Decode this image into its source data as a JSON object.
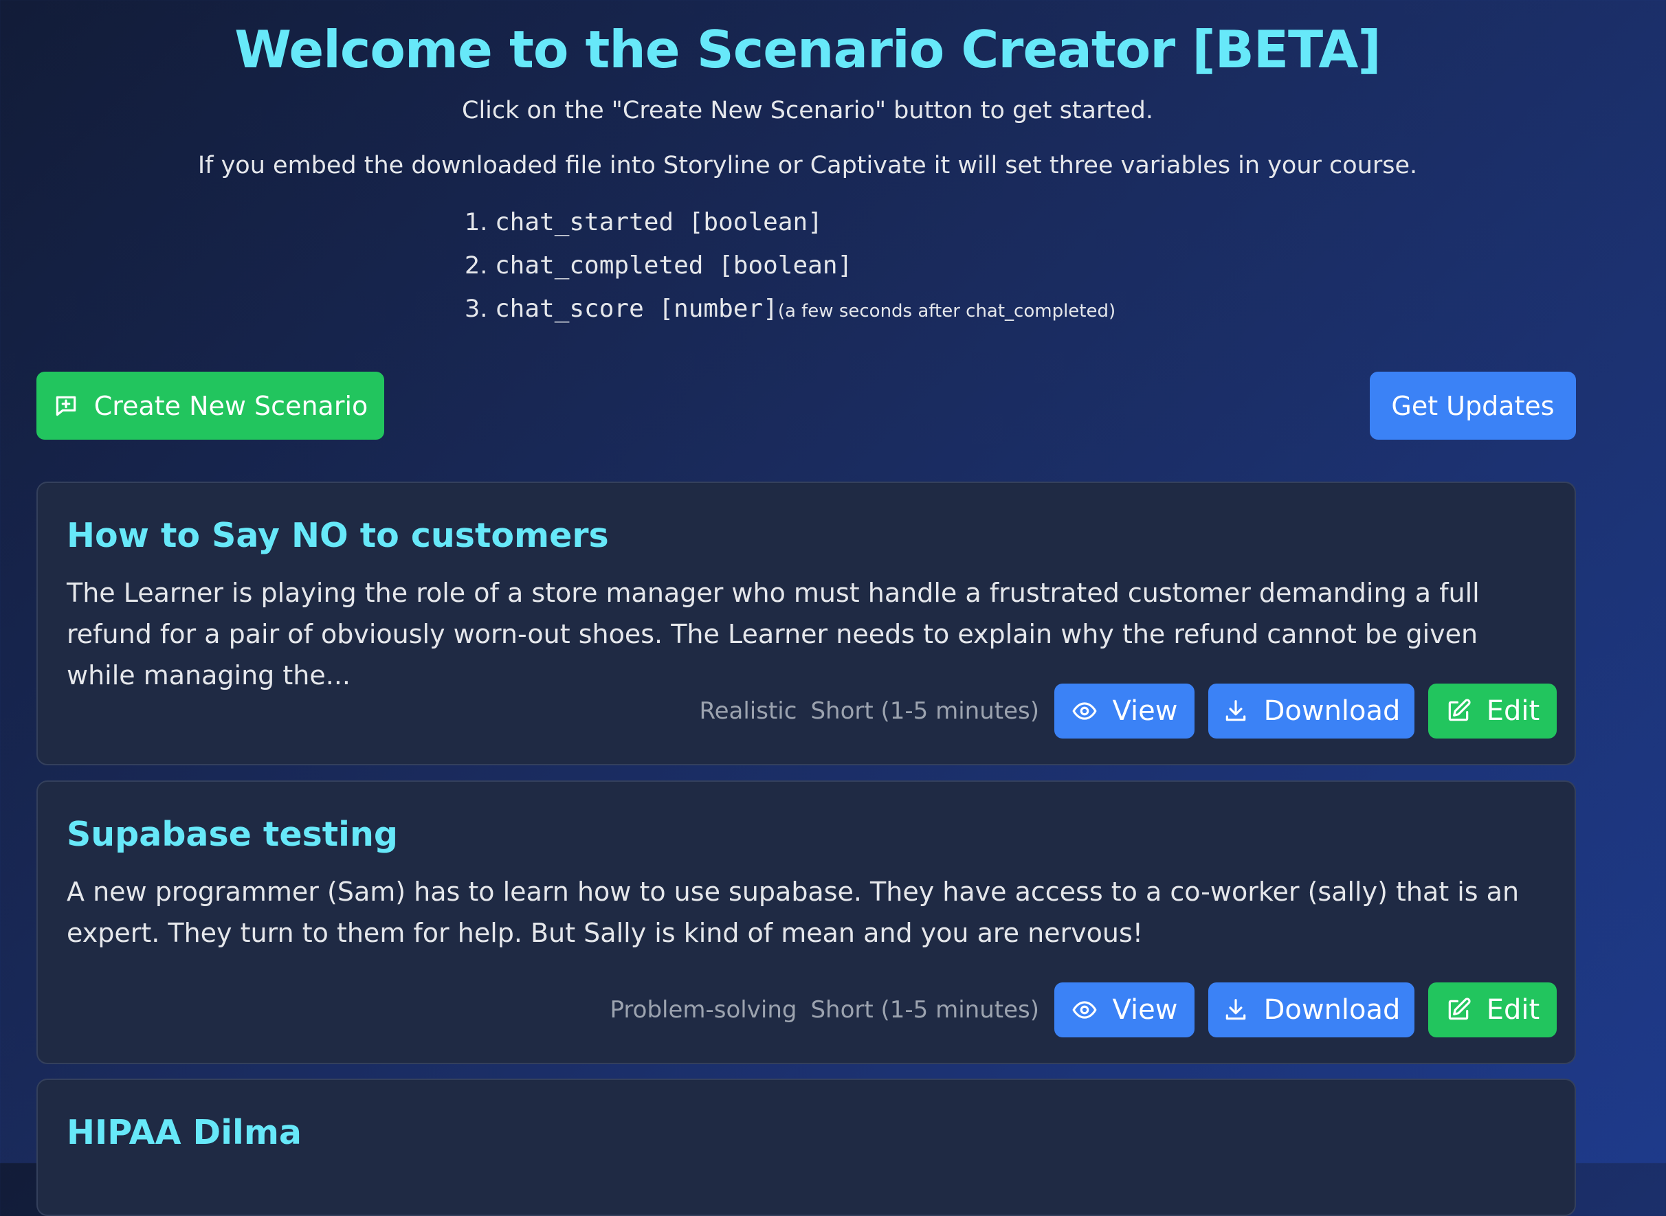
{
  "header": {
    "title": "Welcome to the Scenario Creator [BETA]",
    "intro": "Click on the \"Create New Scenario\" button to get started.",
    "embed_note": "If you embed the downloaded file into Storyline or Captivate it will set three variables in your course.",
    "variables": [
      {
        "number": "1.",
        "code": "chat_started [boolean]",
        "note": ""
      },
      {
        "number": "2.",
        "code": "chat_completed [boolean]",
        "note": ""
      },
      {
        "number": "3.",
        "code": "chat_score [number]",
        "note": "(a few seconds after chat_completed)"
      }
    ]
  },
  "toolbar": {
    "create_label": "Create New Scenario",
    "create_icon": "message-plus-icon",
    "updates_label": "Get Updates"
  },
  "scenarios": [
    {
      "title": "How to Say NO to customers",
      "description": "The Learner is playing the role of a store manager who must handle a frustrated customer demanding a full refund for a pair of obviously worn-out shoes. The Learner needs to explain why the refund cannot be given while managing the...",
      "style": "Realistic",
      "length": "Short (1-5 minutes)"
    },
    {
      "title": "Supabase testing",
      "description": "A new programmer (Sam) has to learn how to use supabase. They have access to a co-worker (sally) that is an expert. They turn to them for help. But Sally is kind of mean and you are nervous!",
      "style": "Problem-solving",
      "length": "Short (1-5 minutes)"
    },
    {
      "title": "HIPAA Dilma"
    }
  ],
  "actions": {
    "view_label": "View",
    "download_label": "Download",
    "edit_label": "Edit"
  },
  "colors": {
    "accent_cyan": "#67e8f9",
    "green": "#22c55e",
    "blue": "#3b82f6",
    "card_bg": "#1f2a44"
  }
}
